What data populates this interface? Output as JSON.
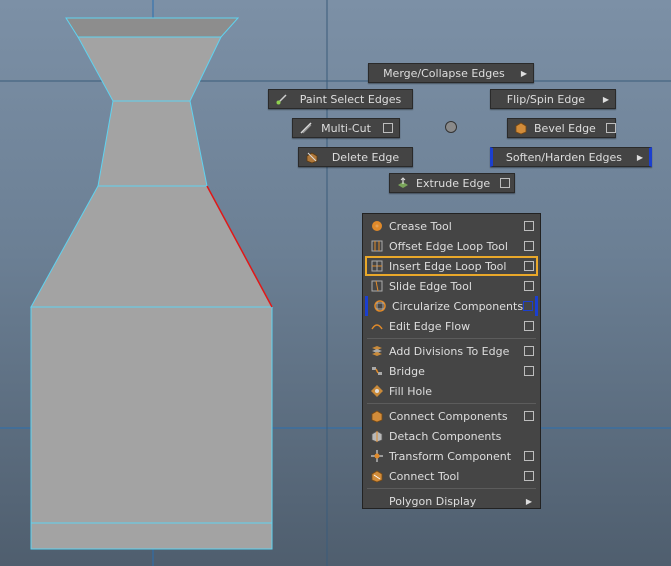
{
  "marking_menu": {
    "merge_collapse": {
      "label": "Merge/Collapse Edges"
    },
    "paint_select": {
      "label": "Paint Select Edges"
    },
    "flip_spin": {
      "label": "Flip/Spin Edge"
    },
    "multi_cut": {
      "label": "Multi-Cut"
    },
    "bevel": {
      "label": "Bevel Edge"
    },
    "delete_edge": {
      "label": "Delete Edge"
    },
    "soften_harden": {
      "label": "Soften/Harden Edges"
    },
    "extrude_edge": {
      "label": "Extrude Edge"
    }
  },
  "menu": {
    "items": [
      {
        "label": "Crease Tool"
      },
      {
        "label": "Offset Edge Loop Tool"
      },
      {
        "label": "Insert Edge Loop Tool"
      },
      {
        "label": "Slide Edge Tool"
      },
      {
        "label": "Circularize Components"
      },
      {
        "label": "Edit Edge Flow"
      },
      {
        "label": "Add Divisions To Edge"
      },
      {
        "label": "Bridge"
      },
      {
        "label": "Fill Hole"
      },
      {
        "label": "Connect Components"
      },
      {
        "label": "Detach Components"
      },
      {
        "label": "Transform Component"
      },
      {
        "label": "Connect Tool"
      },
      {
        "label": "Polygon Display"
      }
    ]
  },
  "colors": {
    "highlight_orange": "#e9a82a",
    "highlight_blue": "#1b3fcf",
    "selected_edge": "#e01818",
    "wireframe": "#5fd3f0"
  }
}
